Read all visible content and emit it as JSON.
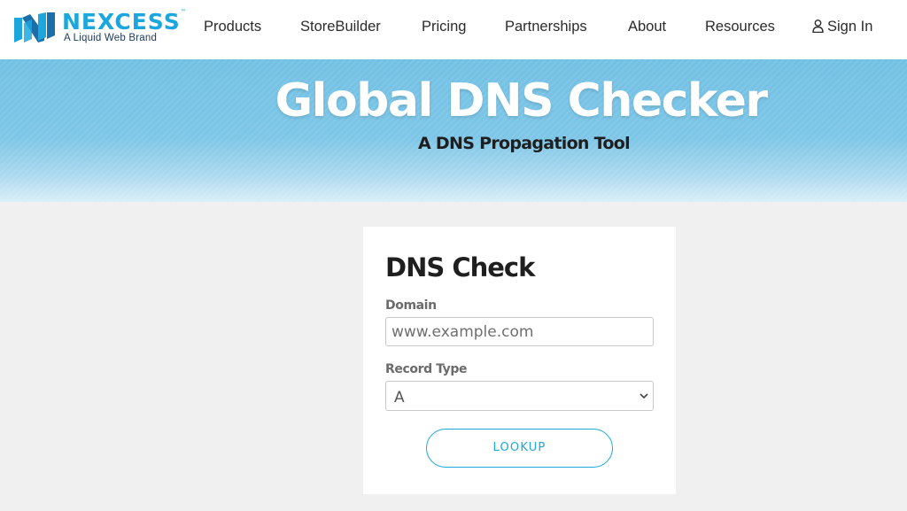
{
  "brand": {
    "name": "NEXCESS",
    "trademark": "™",
    "tagline": "A Liquid Web Brand",
    "accent_color": "#1ba7dd",
    "dark_color": "#1b3a5c"
  },
  "nav": {
    "items": [
      {
        "label": "Products"
      },
      {
        "label": "StoreBuilder"
      },
      {
        "label": "Pricing"
      },
      {
        "label": "Partnerships"
      },
      {
        "label": "About"
      },
      {
        "label": "Resources"
      }
    ],
    "sign_in": {
      "label": "Sign In",
      "icon": "user-icon"
    }
  },
  "hero": {
    "title": "Global DNS Checker",
    "subtitle": "A DNS Propagation Tool",
    "background_color": "#7fc6e6"
  },
  "form": {
    "title": "DNS Check",
    "domain": {
      "label": "Domain",
      "placeholder": "www.example.com",
      "value": ""
    },
    "record_type": {
      "label": "Record Type",
      "selected": "A",
      "icon": "chevron-down-icon"
    },
    "submit_label": "LOOKUP"
  }
}
